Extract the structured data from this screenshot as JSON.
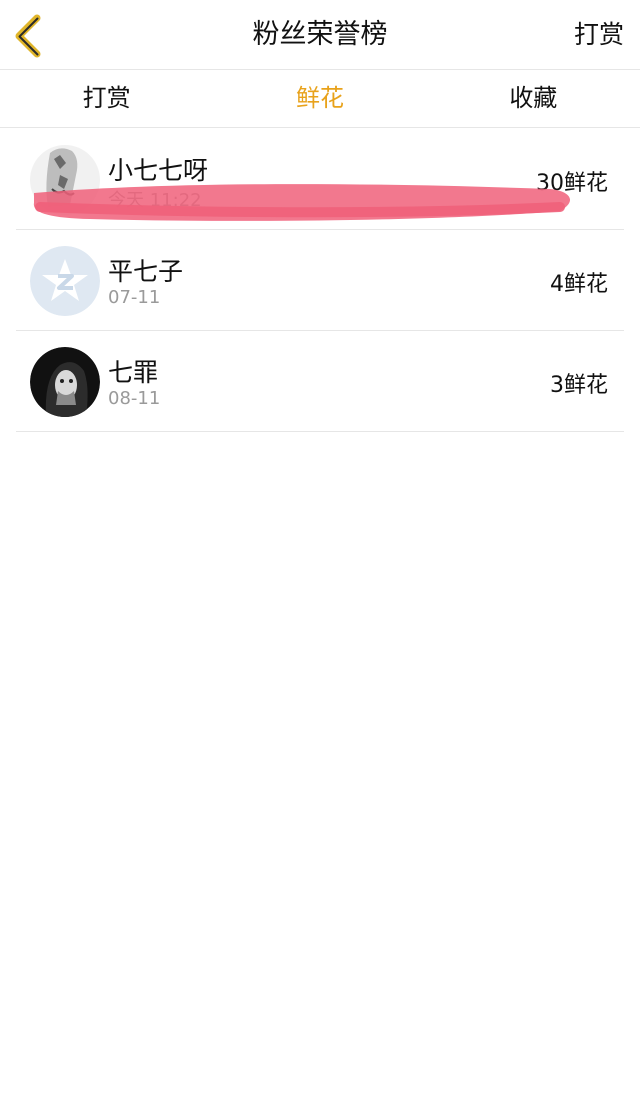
{
  "header": {
    "title": "粉丝荣誉榜",
    "action_label": "打赏"
  },
  "tabs": [
    {
      "label": "打赏",
      "active": false
    },
    {
      "label": "鲜花",
      "active": true
    },
    {
      "label": "收藏",
      "active": false
    }
  ],
  "fans": [
    {
      "name": "小七七呀",
      "date": "今天 11:22",
      "amount": "30鲜花"
    },
    {
      "name": "平七子",
      "date": "07-11",
      "amount": "4鲜花"
    },
    {
      "name": "七罪",
      "date": "08-11",
      "amount": "3鲜花"
    }
  ],
  "colors": {
    "accent": "#E8A21B",
    "divider": "#e6e6e6",
    "secondary_text": "#9a9a9a",
    "redaction": "#f0607a"
  }
}
